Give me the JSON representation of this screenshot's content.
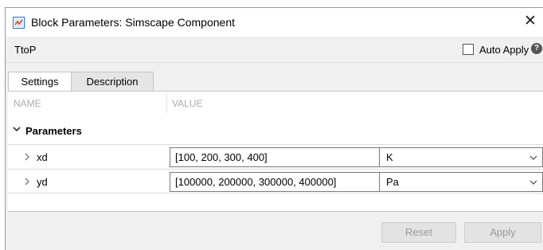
{
  "window": {
    "title": "Block Parameters: Simscape Component",
    "close_glyph": "✕"
  },
  "toolbar": {
    "block_name": "TtoP",
    "auto_apply_label": "Auto Apply",
    "auto_apply_checked": false,
    "help_glyph": "?"
  },
  "tabs": [
    {
      "label": "Settings",
      "active": true
    },
    {
      "label": "Description",
      "active": false
    }
  ],
  "table": {
    "columns": [
      "NAME",
      "VALUE"
    ],
    "group": {
      "label": "Parameters",
      "expanded": true
    },
    "rows": [
      {
        "name": "xd",
        "value": "[100, 200, 300, 400]",
        "unit": "K"
      },
      {
        "name": "yd",
        "value": "[100000, 200000, 300000, 400000]",
        "unit": "Pa"
      }
    ]
  },
  "buttons": {
    "reset": "Reset",
    "apply": "Apply"
  },
  "colors": {
    "window_bg": "#f0f0f0",
    "panel_bg": "#ffffff",
    "disabled_text": "#9a9a9a",
    "header_text": "#aaaaaa"
  }
}
